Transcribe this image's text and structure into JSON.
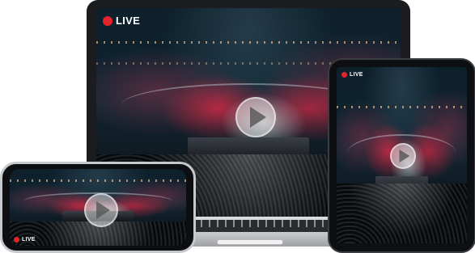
{
  "devices": {
    "laptop": {
      "live_label": "LIVE"
    },
    "tablet": {
      "live_label": "LIVE"
    },
    "phone": {
      "live_label": "LIVE"
    }
  },
  "colors": {
    "live_dot": "#e3242b",
    "stage_red": "#e62846",
    "screen_bg": "#0f2632"
  },
  "icons": {
    "play": "play-icon",
    "live_dot": "record-dot-icon"
  }
}
